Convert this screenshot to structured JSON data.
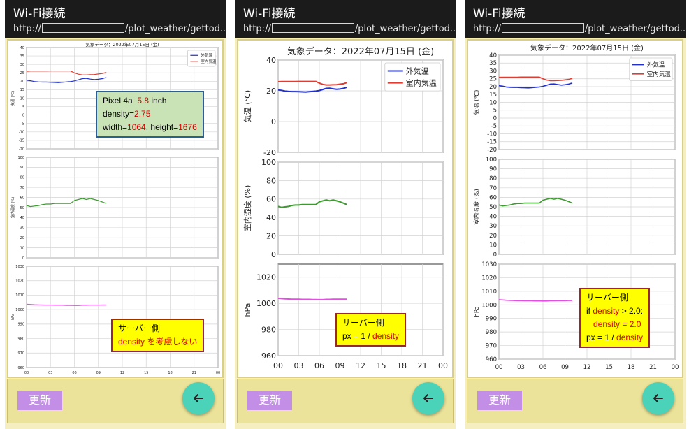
{
  "app": {
    "title": "Wi-Fi接続",
    "url_prefix": "http://",
    "url_suffix": "/plot_weather/gettod..."
  },
  "buttons": {
    "update_label": "更新"
  },
  "colors": {
    "appbar": "#1b1b1b",
    "update_button": "#c28ee6",
    "fab": "#4bd3b9",
    "outdoor_temp": "#1f2fd0",
    "indoor_temp": "#e03c31",
    "humidity": "#3c9a2f",
    "pressure": "#e64ce6"
  },
  "panels": [
    {
      "note": {
        "style": "green",
        "lines": [
          [
            {
              "t": "Pixel 4a  "
            },
            {
              "t": "5.8",
              "r": true
            },
            {
              "t": " inch"
            }
          ],
          [
            {
              "t": "density="
            },
            {
              "t": "2.75",
              "r": true
            }
          ],
          [
            {
              "t": "width="
            },
            {
              "t": "1064",
              "r": true
            },
            {
              "t": ", height="
            },
            {
              "t": "1676",
              "r": true
            }
          ]
        ]
      },
      "note2": {
        "style": "yellow",
        "lines": [
          [
            {
              "t": "サーバー側"
            }
          ],
          [
            {
              "t": "density を考慮しない",
              "r": true
            }
          ]
        ]
      }
    },
    {
      "note": {
        "style": "yellow",
        "lines": [
          [
            {
              "t": "サーバー側"
            }
          ],
          [
            {
              "t": "px = 1 / "
            },
            {
              "t": "density",
              "r": true
            }
          ]
        ]
      }
    },
    {
      "note": {
        "style": "yellow",
        "lines": [
          [
            {
              "t": "サーバー側"
            }
          ],
          [
            {
              "t": "if "
            },
            {
              "t": "density",
              "r": true
            },
            {
              "t": " > 2.0:"
            }
          ],
          [
            {
              "t": "   "
            },
            {
              "t": "density = 2.0",
              "r": true
            }
          ],
          [
            {
              "t": "px = 1 / "
            },
            {
              "t": "density",
              "r": true
            }
          ]
        ]
      }
    }
  ],
  "chart_data": {
    "type": "line",
    "title": "気象データ：2022年07月15日 (金)",
    "x_ticks": [
      "00",
      "03",
      "06",
      "09",
      "12",
      "15",
      "18",
      "21",
      "00"
    ],
    "xlim": [
      0,
      24
    ],
    "subplots": [
      {
        "ylabel": "気温 (℃)",
        "ylim": [
          -20,
          40
        ],
        "yticks_major": [
          -20,
          0,
          20,
          40
        ],
        "yticks_minor": [
          -20,
          -15,
          -10,
          -5,
          0,
          5,
          10,
          15,
          20,
          25,
          30,
          35,
          40
        ],
        "legend": "top-right",
        "series": [
          {
            "name": "外気温",
            "color": "#1f2fd0",
            "x": [
              0,
              0.5,
              1,
              1.5,
              2,
              2.5,
              3,
              3.5,
              4,
              4.5,
              5,
              5.5,
              6,
              6.5,
              7,
              7.5,
              8,
              8.5,
              9,
              9.5,
              10
            ],
            "y": [
              20.6,
              20.3,
              19.8,
              19.6,
              19.5,
              19.5,
              19.4,
              19.3,
              19.2,
              19.4,
              19.6,
              19.8,
              20.2,
              20.9,
              21.6,
              21.7,
              21.3,
              21.0,
              21.2,
              21.6,
              22.3
            ]
          },
          {
            "name": "室内気温",
            "color": "#e03c31",
            "x": [
              0,
              0.5,
              1,
              1.5,
              2,
              2.5,
              3,
              3.5,
              4,
              4.5,
              5,
              5.5,
              6,
              6.5,
              7,
              7.5,
              8,
              8.5,
              9,
              9.5,
              10
            ],
            "y": [
              25.9,
              26.0,
              26.0,
              26.0,
              26.0,
              26.0,
              26.1,
              26.1,
              26.1,
              26.1,
              26.1,
              26.1,
              25.0,
              24.2,
              23.8,
              23.8,
              23.9,
              24.0,
              24.3,
              24.6,
              25.3
            ]
          }
        ]
      },
      {
        "ylabel": "室内湿度 (%)",
        "ylim": [
          0,
          100
        ],
        "yticks_major": [
          0,
          20,
          40,
          60,
          80,
          100
        ],
        "yticks_minor": [
          0,
          10,
          20,
          30,
          40,
          50,
          60,
          70,
          80,
          90,
          100
        ],
        "series": [
          {
            "name": "",
            "color": "#3c9a2f",
            "x": [
              0,
              0.5,
              1,
              1.5,
              2,
              2.5,
              3,
              3.5,
              4,
              4.5,
              5,
              5.5,
              6,
              6.5,
              7,
              7.5,
              8,
              8.5,
              9,
              9.5,
              10
            ],
            "y": [
              52,
              51,
              51.5,
              52,
              53,
              53.5,
              53.5,
              54,
              54,
              54,
              54,
              54,
              57,
              58,
              59,
              58,
              59,
              58,
              57,
              55.5,
              54
            ]
          }
        ]
      },
      {
        "ylabel": "hPa",
        "ylim": [
          960,
          1030
        ],
        "yticks_major": [
          960,
          980,
          1000,
          1020
        ],
        "yticks_minor": [
          960,
          970,
          980,
          990,
          1000,
          1010,
          1020,
          1030
        ],
        "series": [
          {
            "name": "",
            "color": "#e64ce6",
            "x": [
              0,
              0.5,
              1,
              1.5,
              2,
              2.5,
              3,
              3.5,
              4,
              4.5,
              5,
              5.5,
              6,
              6.5,
              7,
              7.5,
              8,
              8.5,
              9,
              9.5,
              10
            ],
            "y": [
              1003.8,
              1003.6,
              1003.4,
              1003.3,
              1003.2,
              1003.1,
              1003.1,
              1003.0,
              1003.0,
              1003.0,
              1002.9,
              1002.9,
              1002.8,
              1002.8,
              1003.0,
              1003.0,
              1003.1,
              1003.1,
              1003.1,
              1003.2,
              1003.2
            ]
          }
        ]
      }
    ]
  }
}
